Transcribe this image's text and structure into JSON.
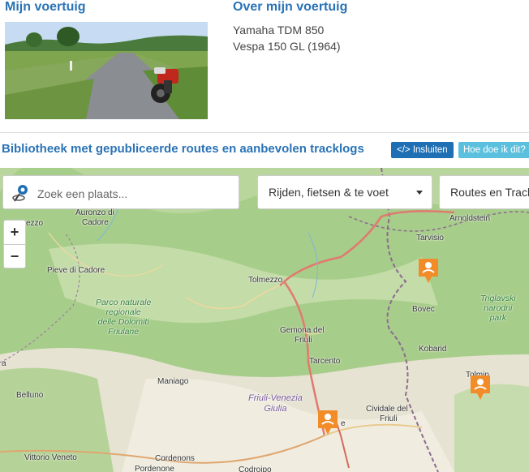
{
  "vehicle": {
    "heading": "Mijn voertuig",
    "about_heading": "Over mijn voertuig",
    "items": [
      "Yamaha TDM 850",
      "Vespa 150 GL (1964)"
    ]
  },
  "library": {
    "title": "Bibliotheek met gepubliceerde routes en aanbevolen tracklogs",
    "embed_label": "Insluiten",
    "embed_icon": "</>",
    "howto_label": "Hoe doe ik dit?"
  },
  "map": {
    "search_placeholder": "Zoek een plaats...",
    "filter_activity": "Rijden, fietsen & te voet",
    "filter_type": "Routes en Tracklogs",
    "zoom_in": "+",
    "zoom_out": "−",
    "places": {
      "auronzo": "Auronzo di",
      "cadore": "Cadore",
      "ezzo": "ezzo",
      "arnoldstein": "Arnoldstein",
      "tarvisio": "Tarvisio",
      "pieve": "Pieve di Cadore",
      "tolmezzo": "Tolmezzo",
      "bovec": "Bovec",
      "gemona": "Gemona del",
      "friuli": "Friuli",
      "kobarid": "Kobarid",
      "tarcento": "Tarcento",
      "tolmin": "Tolmin",
      "maniago": "Maniago",
      "belluno": "Belluno",
      "cividale": "Cividale del",
      "cividale2": "Friuli",
      "cordenons": "Cordenons",
      "vittorio": "Vittorio Veneto",
      "pordenone": "Pordenone",
      "codroipo": "Codroipo",
      "udine_partial": "e",
      "a_partial": "a"
    },
    "park_dolomiti": [
      "Parco naturale",
      "regionale",
      "delle Dolomiti",
      "Friulane"
    ],
    "park_triglav": [
      "Triglavski",
      "narodni",
      "park"
    ],
    "region": [
      "Friuli-Venezia",
      "Giulia"
    ]
  }
}
